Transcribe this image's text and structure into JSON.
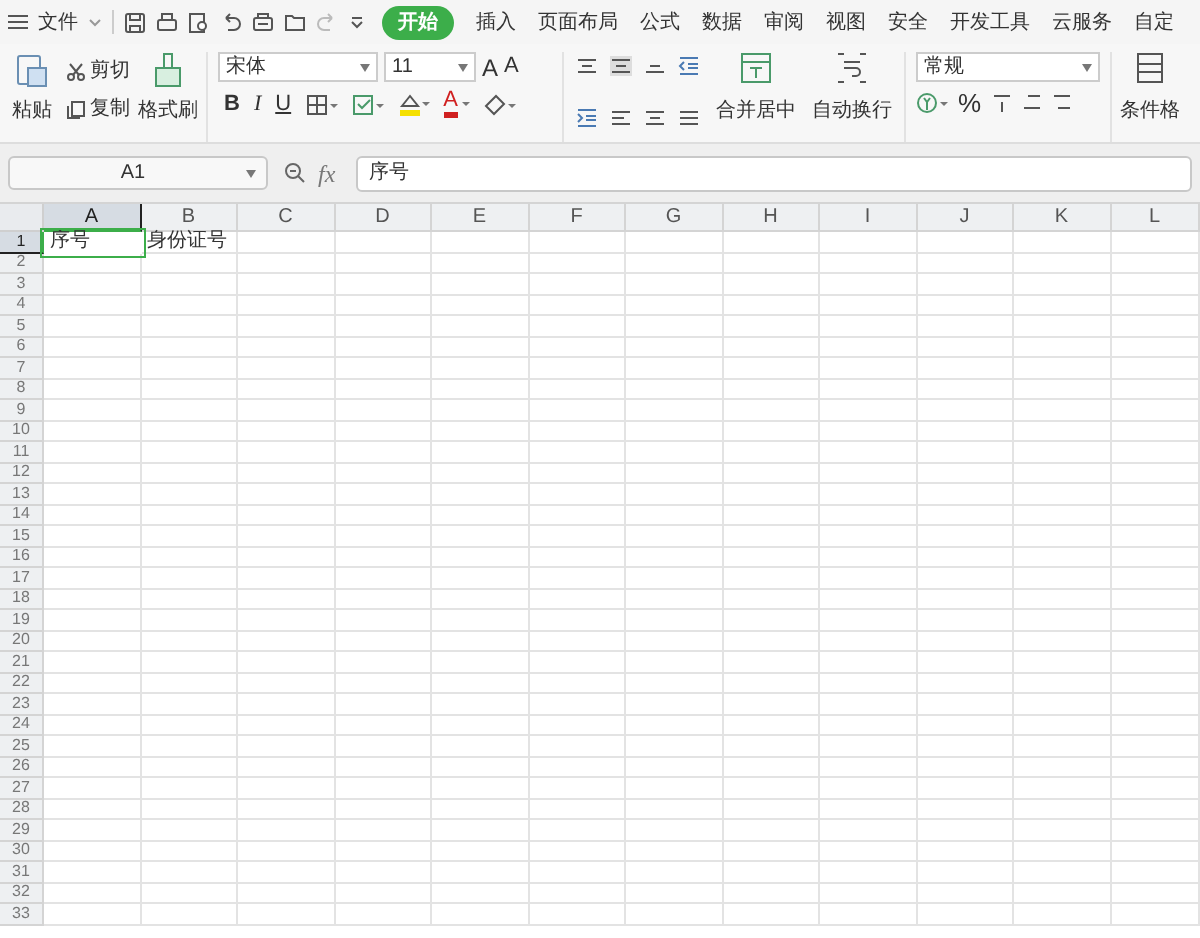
{
  "menu": {
    "file": "文件"
  },
  "tabs": [
    {
      "label": "开始",
      "selected": true
    },
    {
      "label": "插入",
      "selected": false
    },
    {
      "label": "页面布局",
      "selected": false
    },
    {
      "label": "公式",
      "selected": false
    },
    {
      "label": "数据",
      "selected": false
    },
    {
      "label": "审阅",
      "selected": false
    },
    {
      "label": "视图",
      "selected": false
    },
    {
      "label": "安全",
      "selected": false
    },
    {
      "label": "开发工具",
      "selected": false
    },
    {
      "label": "云服务",
      "selected": false
    },
    {
      "label": "自定",
      "selected": false
    }
  ],
  "ribbon": {
    "paste": "粘贴",
    "cut": "剪切",
    "copy": "复制",
    "format_painter": "格式刷",
    "font_name": "宋体",
    "font_size": "11",
    "grow_font": "A",
    "shrink_font": "A",
    "bold": "B",
    "italic": "I",
    "underline": "U",
    "font_color": "A",
    "merge_center": "合并居中",
    "wrap_text": "自动换行",
    "number_format": "常规",
    "percent": "%",
    "conditional_format": "条件格"
  },
  "formula_bar": {
    "name_box": "A1",
    "fx": "fx",
    "value": "序号"
  },
  "columns": [
    {
      "label": "A",
      "selected": true
    },
    {
      "label": "B",
      "selected": false
    },
    {
      "label": "C",
      "selected": false
    },
    {
      "label": "D",
      "selected": false
    },
    {
      "label": "E",
      "selected": false
    },
    {
      "label": "F",
      "selected": false
    },
    {
      "label": "G",
      "selected": false
    },
    {
      "label": "H",
      "selected": false
    },
    {
      "label": "I",
      "selected": false
    },
    {
      "label": "J",
      "selected": false
    },
    {
      "label": "K",
      "selected": false
    },
    {
      "label": "L",
      "selected": false
    }
  ],
  "rows": [
    {
      "label": "1",
      "selected": true,
      "cells": [
        {
          "text": "序号",
          "selected": true
        },
        {
          "text": "身份证号",
          "selected": false
        }
      ]
    },
    {
      "label": "2",
      "selected": false
    },
    {
      "label": "3",
      "selected": false
    },
    {
      "label": "4",
      "selected": false
    },
    {
      "label": "5",
      "selected": false
    },
    {
      "label": "6",
      "selected": false
    },
    {
      "label": "7",
      "selected": false
    },
    {
      "label": "8",
      "selected": false
    },
    {
      "label": "9",
      "selected": false
    },
    {
      "label": "10",
      "selected": false
    },
    {
      "label": "11",
      "selected": false
    },
    {
      "label": "12",
      "selected": false
    },
    {
      "label": "13",
      "selected": false
    },
    {
      "label": "14",
      "selected": false
    },
    {
      "label": "15",
      "selected": false
    },
    {
      "label": "16",
      "selected": false
    },
    {
      "label": "17",
      "selected": false
    },
    {
      "label": "18",
      "selected": false
    },
    {
      "label": "19",
      "selected": false
    },
    {
      "label": "20",
      "selected": false
    },
    {
      "label": "21",
      "selected": false
    },
    {
      "label": "22",
      "selected": false
    },
    {
      "label": "23",
      "selected": false
    },
    {
      "label": "24",
      "selected": false
    },
    {
      "label": "25",
      "selected": false
    },
    {
      "label": "26",
      "selected": false
    },
    {
      "label": "27",
      "selected": false
    },
    {
      "label": "28",
      "selected": false
    },
    {
      "label": "29",
      "selected": false
    },
    {
      "label": "30",
      "selected": false
    },
    {
      "label": "31",
      "selected": false
    },
    {
      "label": "32",
      "selected": false
    },
    {
      "label": "33",
      "selected": false
    }
  ]
}
